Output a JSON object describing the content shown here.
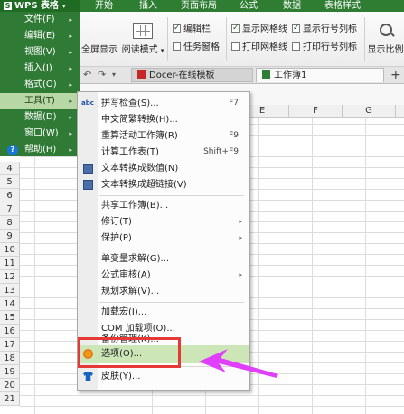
{
  "app": {
    "menu_button": "WPS 表格",
    "logo_letter": "S"
  },
  "tabs": [
    "开始",
    "插入",
    "页面布局",
    "公式",
    "数据",
    "表格样式"
  ],
  "ribbon": {
    "fullscreen": "全屏显示",
    "reading_mode": "阅读模式",
    "edit_bar": "编辑栏",
    "task_pane": "任务窗格",
    "show_gridlines": "显示网格线",
    "print_gridlines": "打印网格线",
    "show_row_col_headers": "显示行号列标",
    "print_row_col_headers": "打印行号列标",
    "zoom": "显示比例"
  },
  "doc_tabs": {
    "template_tab": "Docer-在线模板",
    "workbook_tab": "工作簿1",
    "add_label": "+"
  },
  "columns": [
    "E",
    "F",
    "G"
  ],
  "rows": [
    "4",
    "5",
    "6",
    "7",
    "8",
    "9",
    "10",
    "11",
    "12",
    "13",
    "14",
    "15",
    "16",
    "17",
    "18",
    "19",
    "20",
    "21"
  ],
  "main_menu": [
    {
      "label": "文件(F)"
    },
    {
      "label": "编辑(E)"
    },
    {
      "label": "视图(V)"
    },
    {
      "label": "插入(I)"
    },
    {
      "label": "格式(O)"
    },
    {
      "label": "工具(T)"
    },
    {
      "label": "数据(D)"
    },
    {
      "label": "窗口(W)"
    },
    {
      "label": "帮助(H)"
    }
  ],
  "tools_menu": {
    "spell_check": "拼写检查(S)...",
    "spell_check_key": "F7",
    "trad_simp": "中文简繁转换(H)...",
    "recalc_active": "重算活动工作簿(R)",
    "recalc_active_key": "F9",
    "calc_sheet": "计算工作表(T)",
    "calc_sheet_key": "Shift+F9",
    "text_to_number": "文本转换成数值(N)",
    "text_to_link": "文本转换成超链接(V)",
    "share_workbook": "共享工作簿(B)...",
    "revisions": "修订(T)",
    "protect": "保护(P)",
    "goal_seek": "单变量求解(G)...",
    "formula_audit": "公式审核(A)",
    "solver": "规划求解(V)...",
    "addins": "加载宏(I)...",
    "com_addins": "COM 加载项(O)...",
    "backup": "备份管理(K)...",
    "options": "选项(O)...",
    "skin": "皮肤(Y)..."
  },
  "icons": {
    "spell_check": "abc",
    "chevron": "▸",
    "dropdown": "▾",
    "help": "?"
  },
  "colors": {
    "menu_green": "#2f7a34",
    "highlight": "#cde6b8",
    "annotation_red": "#e53935",
    "annotation_arrow": "#e040fb"
  }
}
